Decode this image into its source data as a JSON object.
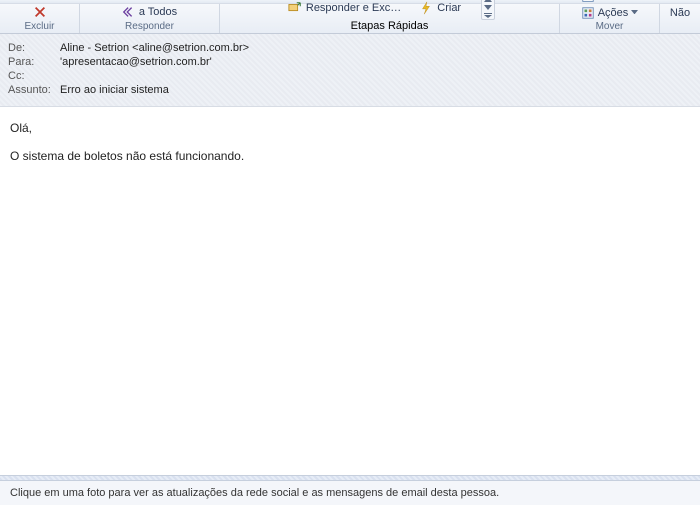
{
  "ribbon": {
    "groups": {
      "excluir": {
        "label": "Excluir",
        "todos": "a Todos"
      },
      "responder": {
        "label": "Responder"
      },
      "etapas": {
        "label": "Etapas Rápidas",
        "item1": "Responder e Exc…",
        "item2": "Criar"
      },
      "mover": {
        "label": "Mover",
        "acoes": "Ações"
      },
      "nao": {
        "label": "Não"
      }
    }
  },
  "header": {
    "labels": {
      "de": "De:",
      "para": "Para:",
      "cc": "Cc:",
      "assunto": "Assunto:"
    },
    "de_name": "Aline - Setrion ",
    "de_email": "<aline@setrion.com.br>",
    "para": "'apresentacao@setrion.com.br'",
    "cc": "",
    "assunto": "Erro ao iniciar sistema"
  },
  "body": {
    "line1": "Olá,",
    "line2": "O sistema de boletos não está funcionando."
  },
  "footer": {
    "text": "Clique em uma foto para ver as atualizações da rede social e as mensagens de email desta pessoa."
  }
}
